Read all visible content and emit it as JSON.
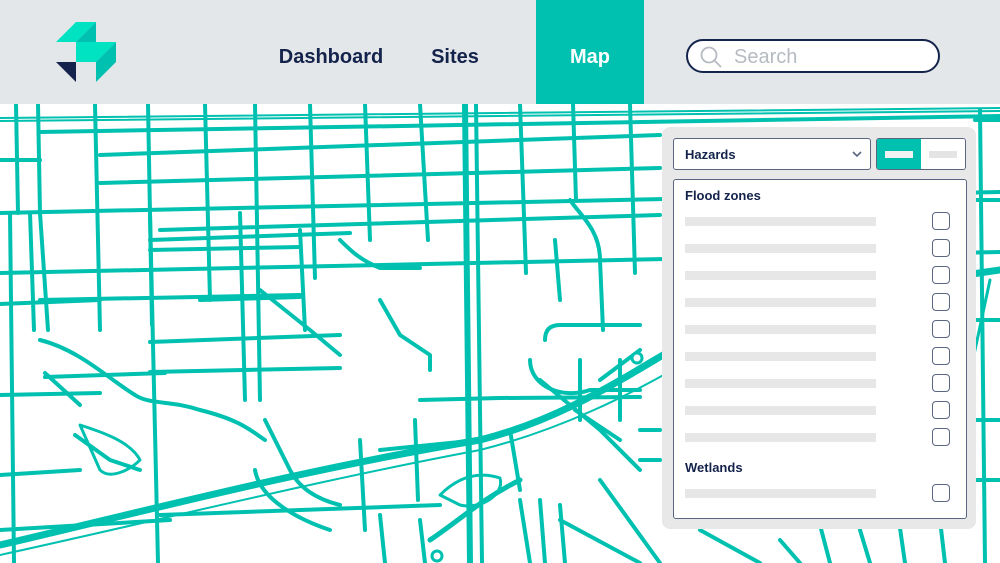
{
  "header": {
    "logo": "brand-logo",
    "nav": [
      {
        "label": "Dashboard",
        "active": false
      },
      {
        "label": "Sites",
        "active": false
      },
      {
        "label": "Map",
        "active": true
      }
    ],
    "search": {
      "placeholder": "Search",
      "value": "",
      "icon": "search-icon"
    }
  },
  "colors": {
    "accent": "#00c1b0",
    "navy": "#14234b",
    "topbar_bg": "#e4e7ea",
    "panel_bg": "#e8e8e8",
    "placeholder_bar": "#e7e7e7",
    "road": "#00c1b0"
  },
  "panel": {
    "category_select": {
      "value": "Hazards",
      "icon": "chevron-down-icon"
    },
    "view_toggle": {
      "options": [
        "view-option-1",
        "view-option-2"
      ],
      "selected_index": 0
    },
    "groups": [
      {
        "title": "Flood zones",
        "items": [
          {
            "label": "",
            "checked": false
          },
          {
            "label": "",
            "checked": false
          },
          {
            "label": "",
            "checked": false
          },
          {
            "label": "",
            "checked": false
          },
          {
            "label": "",
            "checked": false
          },
          {
            "label": "",
            "checked": false
          },
          {
            "label": "",
            "checked": false
          },
          {
            "label": "",
            "checked": false
          },
          {
            "label": "",
            "checked": false
          }
        ]
      },
      {
        "title": "Wetlands",
        "items": [
          {
            "label": "",
            "checked": false
          }
        ]
      }
    ]
  }
}
